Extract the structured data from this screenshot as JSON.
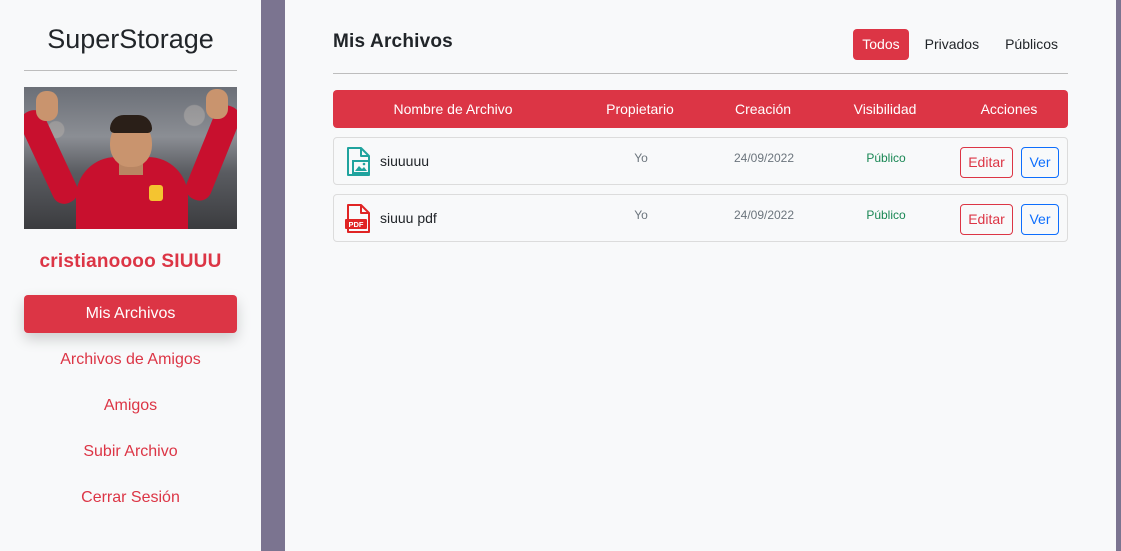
{
  "sidebar": {
    "brand": "SuperStorage",
    "username": "cristianoooo SIUUU",
    "nav": [
      {
        "label": "Mis Archivos",
        "active": true
      },
      {
        "label": "Archivos de Amigos",
        "active": false
      },
      {
        "label": "Amigos",
        "active": false
      },
      {
        "label": "Subir Archivo",
        "active": false
      },
      {
        "label": "Cerrar Sesión",
        "active": false
      }
    ]
  },
  "main": {
    "title": "Mis Archivos",
    "filters": [
      {
        "label": "Todos",
        "active": true
      },
      {
        "label": "Privados",
        "active": false
      },
      {
        "label": "Públicos",
        "active": false
      }
    ],
    "table": {
      "columns": [
        "Nombre de Archivo",
        "Propietario",
        "Creación",
        "Visibilidad",
        "Acciones"
      ],
      "rows": [
        {
          "icon": "image-file-icon",
          "name": "siuuuuu",
          "owner": "Yo",
          "created": "24/09/2022",
          "visibility": "Público",
          "edit_label": "Editar",
          "view_label": "Ver"
        },
        {
          "icon": "pdf-file-icon",
          "name": "siuuu pdf",
          "owner": "Yo",
          "created": "24/09/2022",
          "visibility": "Público",
          "edit_label": "Editar",
          "view_label": "Ver"
        }
      ]
    }
  },
  "colors": {
    "accent": "#dc3545",
    "primary": "#0d6efd",
    "success": "#198754",
    "image_icon": "#20a39e",
    "pdf_icon": "#e02424"
  }
}
